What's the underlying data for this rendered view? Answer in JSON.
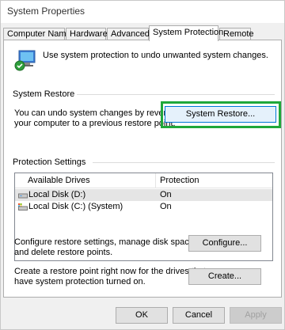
{
  "window": {
    "title": "System Properties"
  },
  "tabs": [
    {
      "label": "Computer Name"
    },
    {
      "label": "Hardware"
    },
    {
      "label": "Advanced"
    },
    {
      "label": "System Protection"
    },
    {
      "label": "Remote"
    }
  ],
  "intro": {
    "text": "Use system protection to undo unwanted system changes."
  },
  "system_restore": {
    "group_label": "System Restore",
    "description_line1": "You can undo system changes by reverting",
    "description_line2": "your computer to a previous restore point.",
    "button_label": "System Restore..."
  },
  "protection_settings": {
    "group_label": "Protection Settings",
    "columns": [
      "Available Drives",
      "Protection"
    ],
    "drives": [
      {
        "name": "Local Disk (D:)",
        "protection": "On",
        "icon": "drive-icon"
      },
      {
        "name": "Local Disk (C:) (System)",
        "protection": "On",
        "icon": "system-drive-icon"
      }
    ]
  },
  "configure": {
    "text_line1": "Configure restore settings, manage disk space,",
    "text_line2": "and delete restore points.",
    "button_label": "Configure..."
  },
  "create": {
    "text_line1": "Create a restore point right now for the drives that",
    "text_line2": "have system protection turned on.",
    "button_label": "Create..."
  },
  "footer": {
    "ok": "OK",
    "cancel": "Cancel",
    "apply": "Apply"
  },
  "colors": {
    "highlight": "#1fa83a",
    "focus": "#0078d7"
  }
}
